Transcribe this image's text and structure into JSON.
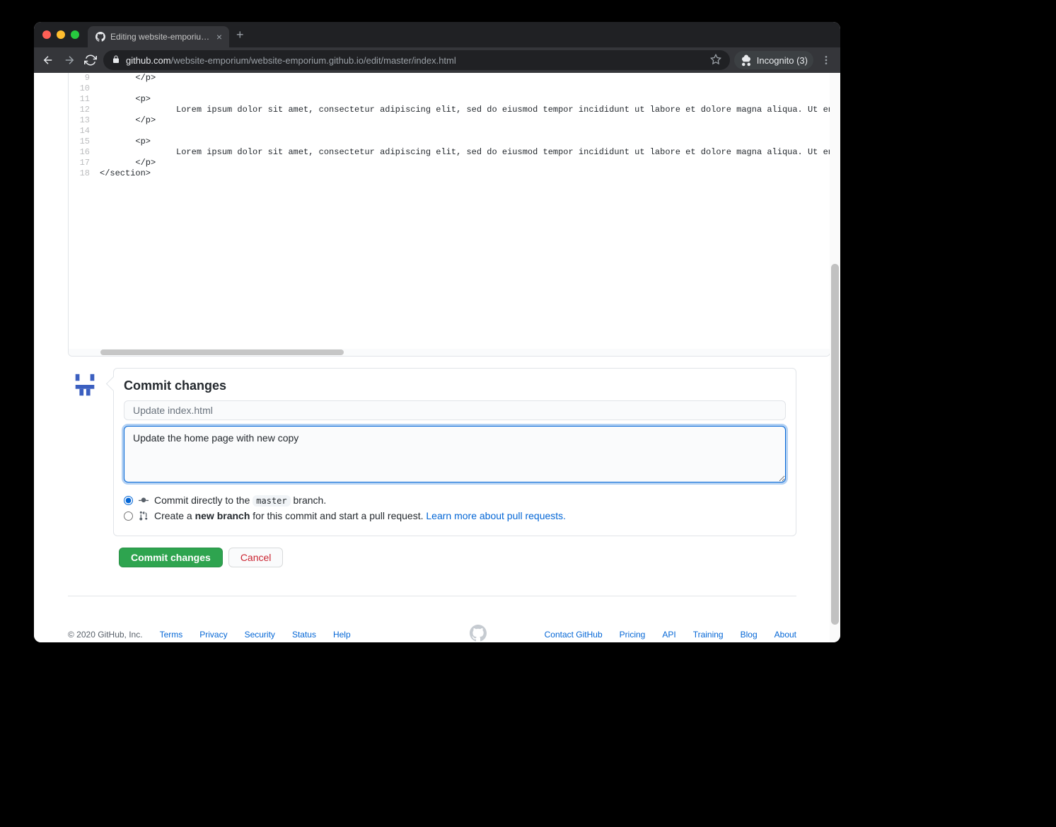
{
  "browser": {
    "tab_title": "Editing website-emporium.gith",
    "url_domain": "github.com",
    "url_path": "/website-emporium/website-emporium.github.io/edit/master/index.html",
    "incognito_label": "Incognito (3)"
  },
  "editor": {
    "lines": [
      {
        "n": 9,
        "text": "       </p>"
      },
      {
        "n": 10,
        "text": ""
      },
      {
        "n": 11,
        "text": "       <p>"
      },
      {
        "n": 12,
        "text": "               Lorem ipsum dolor sit amet, consectetur adipiscing elit, sed do eiusmod tempor incididunt ut labore et dolore magna aliqua. Ut enim ad minim veniam,"
      },
      {
        "n": 13,
        "text": "       </p>"
      },
      {
        "n": 14,
        "text": ""
      },
      {
        "n": 15,
        "text": "       <p>"
      },
      {
        "n": 16,
        "text": "               Lorem ipsum dolor sit amet, consectetur adipiscing elit, sed do eiusmod tempor incididunt ut labore et dolore magna aliqua. Ut enim ad minim veniam,"
      },
      {
        "n": 17,
        "text": "       </p>"
      },
      {
        "n": 18,
        "text": "</section>"
      }
    ]
  },
  "commit": {
    "heading": "Commit changes",
    "summary_placeholder": "Update index.html",
    "description_value": "Update the home page with new copy",
    "radio_direct_pre": "Commit directly to the ",
    "radio_direct_branch": "master",
    "radio_direct_post": " branch.",
    "radio_new_pre": "Create a ",
    "radio_new_bold": "new branch",
    "radio_new_post": " for this commit and start a pull request. ",
    "radio_new_link": "Learn more about pull requests.",
    "submit_label": "Commit changes",
    "cancel_label": "Cancel"
  },
  "footer": {
    "copyright": "© 2020 GitHub, Inc.",
    "left_links": [
      "Terms",
      "Privacy",
      "Security",
      "Status",
      "Help"
    ],
    "right_links": [
      "Contact GitHub",
      "Pricing",
      "API",
      "Training",
      "Blog",
      "About"
    ]
  }
}
